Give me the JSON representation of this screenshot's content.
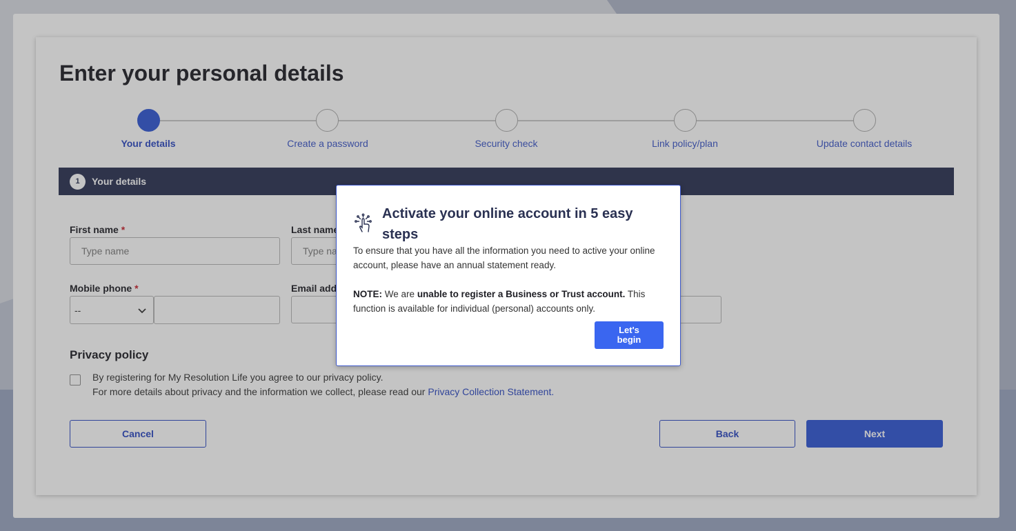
{
  "page": {
    "title": "Enter your personal details"
  },
  "stepper": {
    "steps": [
      {
        "label": "Your details",
        "active": true
      },
      {
        "label": "Create a password",
        "active": false
      },
      {
        "label": "Security check",
        "active": false
      },
      {
        "label": "Link policy/plan",
        "active": false
      },
      {
        "label": "Update contact details",
        "active": false
      }
    ]
  },
  "section": {
    "number": "1",
    "title": "Your details"
  },
  "form": {
    "first_name": {
      "label": "First name",
      "required_mark": "*",
      "placeholder": "Type name"
    },
    "last_name": {
      "label": "Last name",
      "placeholder": "Type name"
    },
    "mobile_phone": {
      "label": "Mobile phone",
      "required_mark": "*",
      "country_code_selected": "--"
    },
    "email": {
      "label": "Email address"
    }
  },
  "privacy": {
    "title": "Privacy policy",
    "line1": "By registering for My Resolution Life you agree to our privacy policy.",
    "line2": "For more details about privacy and the information we collect, please read our",
    "link": "Privacy Collection Statement."
  },
  "buttons": {
    "cancel": "Cancel",
    "back": "Back",
    "next": "Next"
  },
  "modal": {
    "title": "Activate your online account in 5 easy steps",
    "body1": "To ensure that you have all the information you need to active your online account, please have an annual statement ready.",
    "note_label": "NOTE:",
    "note_pre": "We are",
    "note_bold": "unable to register a Business or Trust account.",
    "note_post": "This function is available for individual (personal) accounts only.",
    "button_line1": "Let's",
    "button_line2": "begin",
    "icon": "touch-gesture-icon"
  },
  "colors": {
    "primary": "#3057d5",
    "navy": "#2a3152",
    "required": "#c8202b"
  }
}
